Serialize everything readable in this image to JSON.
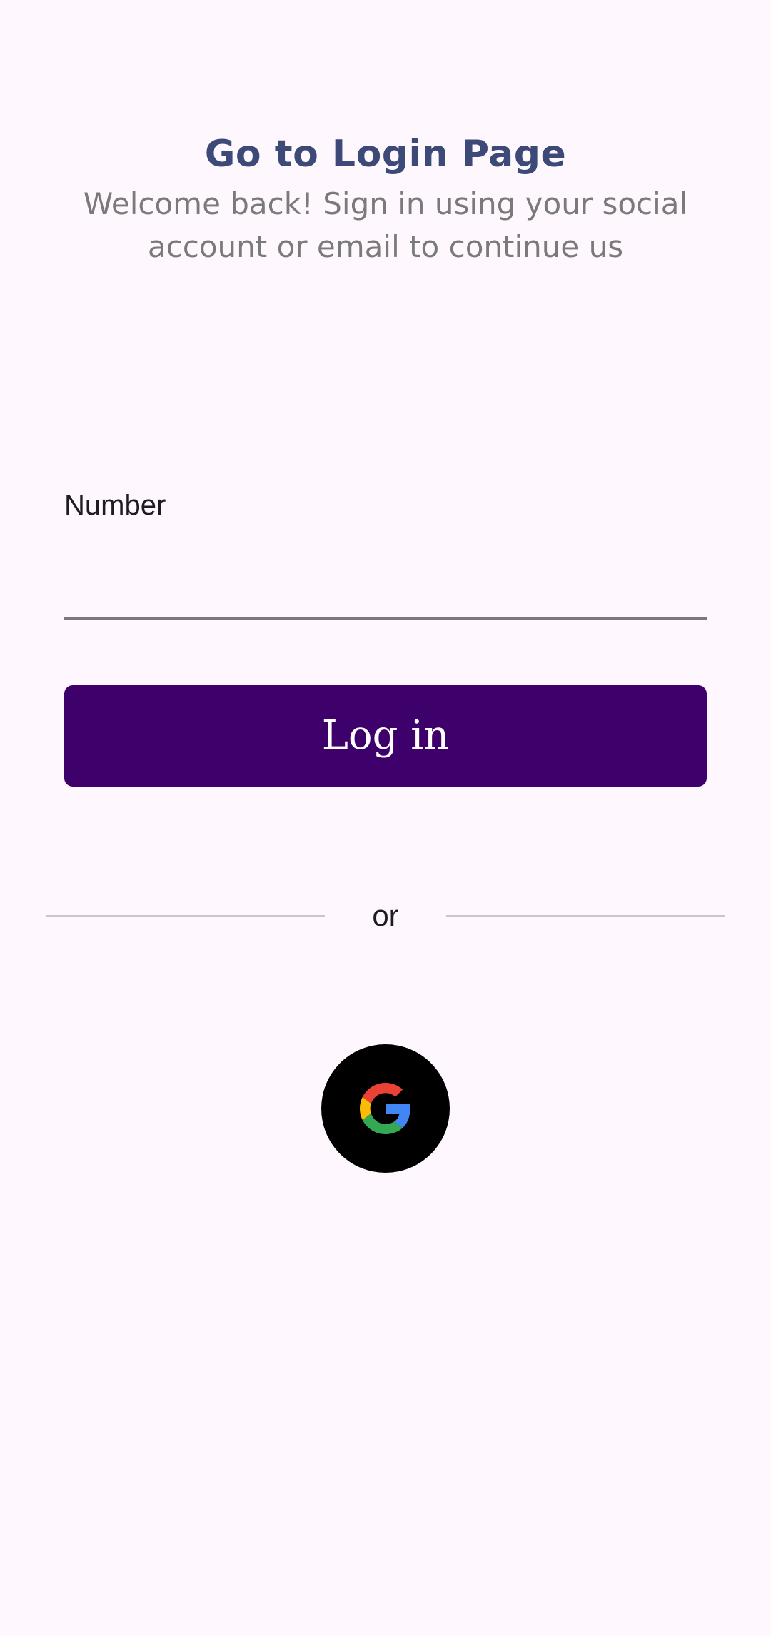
{
  "header": {
    "title": "Go to Login Page",
    "subtitle": "Welcome back! Sign in using your social account or email to continue us"
  },
  "form": {
    "number_label": "Number",
    "number_value": "",
    "number_placeholder": ""
  },
  "login_button": {
    "label": "Log in"
  },
  "divider": {
    "text": "or"
  },
  "social": {
    "google_icon": "google-logo-icon"
  },
  "colors": {
    "background": "#fef7fd",
    "title": "#3d4a77",
    "subtitle": "#7a7a7a",
    "primary_button": "#3e006b",
    "divider": "#cbc4cf",
    "social_button": "#000000"
  }
}
